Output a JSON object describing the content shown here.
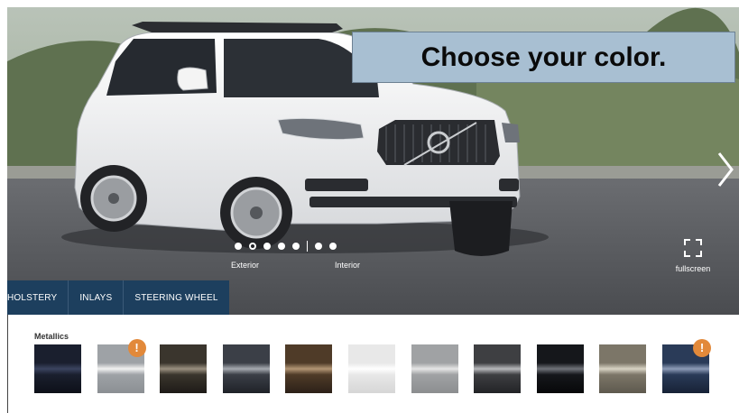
{
  "callout": {
    "text": "Choose your color."
  },
  "viewer": {
    "views": [
      "Exterior",
      "Interior"
    ],
    "fullscreen_label": "fullscreen",
    "exterior_dots": 5,
    "active_dot": 2,
    "interior_dots": 2
  },
  "tabs": [
    "HOLSTERY",
    "INLAYS",
    "STEERING WHEEL"
  ],
  "colors": {
    "section_label": "Metallics",
    "badge_text": "!",
    "swatches": [
      {
        "name": "dark-blue-black",
        "colors": [
          "#1a1f2e",
          "#3b4460",
          "#0d1018"
        ],
        "badge": false
      },
      {
        "name": "silver",
        "colors": [
          "#9ea2a6",
          "#f2f2f2",
          "#8b8f93"
        ],
        "badge": true
      },
      {
        "name": "dark-gray-brown",
        "colors": [
          "#3a352d",
          "#9a9080",
          "#1e1b17"
        ],
        "badge": false
      },
      {
        "name": "charcoal",
        "colors": [
          "#3b3f47",
          "#a6aab0",
          "#1f2228"
        ],
        "badge": false
      },
      {
        "name": "bronze-brown",
        "colors": [
          "#4f3b28",
          "#b39675",
          "#2c2118"
        ],
        "badge": false
      },
      {
        "name": "white",
        "colors": [
          "#e8e8e8",
          "#ffffff",
          "#d6d6d6"
        ],
        "badge": false
      },
      {
        "name": "light-silver",
        "colors": [
          "#a0a2a4",
          "#e6e6e6",
          "#8c8e90"
        ],
        "badge": false
      },
      {
        "name": "graphite",
        "colors": [
          "#3e3f42",
          "#b8b9bc",
          "#222326"
        ],
        "badge": false
      },
      {
        "name": "black",
        "colors": [
          "#15171b",
          "#70737a",
          "#070809"
        ],
        "badge": false
      },
      {
        "name": "champagne",
        "colors": [
          "#7c7668",
          "#d8d3c4",
          "#5e594e"
        ],
        "badge": false
      },
      {
        "name": "denim-blue",
        "colors": [
          "#2a3b58",
          "#8e9db8",
          "#172236"
        ],
        "badge": true
      }
    ]
  }
}
